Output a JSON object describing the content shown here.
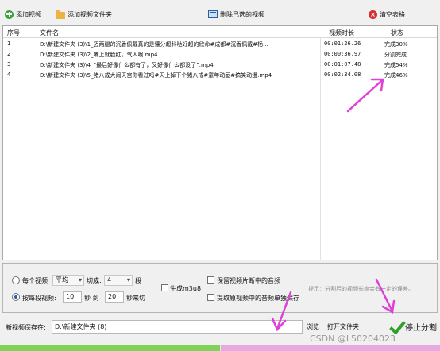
{
  "toolbar": {
    "add_video": "添加视频",
    "add_folder": "添加视频文件夹",
    "delete_selected": "删除已选的视频",
    "clear_table": "清空表格"
  },
  "table": {
    "headers": [
      "序号",
      "文件名",
      "视频时长",
      "状态"
    ],
    "rows": [
      {
        "index": "1",
        "filename": "D:\\新建文件夹 (3)\\1_迈两腿的沉香佩戴真的是懂分超科哒好超的欣命#成都#沉香佩戴#杨...",
        "duration": "00:01:26.26",
        "status": "完成30%"
      },
      {
        "index": "2",
        "filename": "D:\\新建文件夹 (3)\\2_嘴上就脸红，气人啊.mp4",
        "duration": "00:00:36.97",
        "status": "分割完成"
      },
      {
        "index": "3",
        "filename": "D:\\新建文件夹 (3)\\4_“最后好像什么都有了，又好像什么都没了”.mp4",
        "duration": "00:01:07.48",
        "status": "完成54%"
      },
      {
        "index": "4",
        "filename": "D:\\新建文件夹 (3)\\5_猪八戒大闹天宫你看过吗#天上掉下个猪八戒#童年动画#搞笑动漫.mp4",
        "duration": "00:02:34.08",
        "status": "完成46%"
      }
    ]
  },
  "options": {
    "each_video_label": "每个视频",
    "mode_value": "平均",
    "cut_label": "切成:",
    "cut_count": "4",
    "segment_unit": "段",
    "by_segment_label": "按每段视频:",
    "from_value": "10",
    "seconds_to": "秒 到",
    "to_value": "20",
    "seconds_cut": "秒来切",
    "generate_m3u8": "生成m3u8",
    "keep_audio": "保留视频片断中的音频",
    "extract_audio": "提取原视频中的音频单独保存",
    "hint": "提示：分割后的视频长度会有一定的误差。"
  },
  "save": {
    "label": "新视频保存在:",
    "path": "D:\\新建文件夹 (8)",
    "browse": "浏览",
    "open_folder": "打开文件夹"
  },
  "stop_button": "停止分割",
  "progress": {
    "fraction": 0.5
  },
  "watermark": "CSDN @L50204023",
  "colors": {
    "accent_green": "#2da12d",
    "arrow_magenta": "#e040d8"
  }
}
